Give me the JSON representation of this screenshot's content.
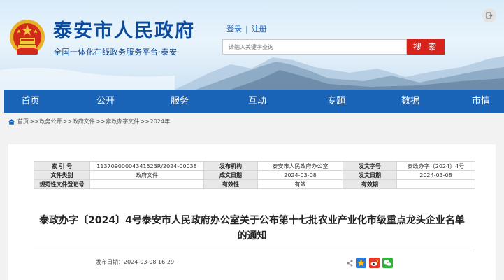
{
  "header": {
    "site_title": "泰安市人民政府",
    "site_subtitle": "全国一体化在线政务服务平台·泰安",
    "login_label": "登录",
    "register_label": "注册",
    "search_placeholder": "请输入关键字查询",
    "search_button": "搜 索"
  },
  "nav": {
    "items": [
      {
        "label": "首页"
      },
      {
        "label": "公开"
      },
      {
        "label": "服务"
      },
      {
        "label": "互动"
      },
      {
        "label": "专题"
      },
      {
        "label": "数据"
      },
      {
        "label": "市情"
      }
    ]
  },
  "breadcrumb": {
    "items": [
      "首页",
      "政务公开",
      "政府文件",
      "泰政办字文件",
      "2024年"
    ],
    "separator": ">>"
  },
  "meta": {
    "index_key": "索 引 号",
    "index_value": "11370900004341523R/2024-00038",
    "issuer_key": "发布机构",
    "issuer_value": "泰安市人民政府办公室",
    "doc_no_key": "发文字号",
    "doc_no_value": "泰政办字〔2024〕4号",
    "category_key": "文件类别",
    "category_value": "政府文件",
    "created_key": "成文日期",
    "created_value": "2024-03-08",
    "issued_key": "发文日期",
    "issued_value": "2024-03-08",
    "reg_key": "规范性文件登记号",
    "reg_value": "",
    "validity_key": "有效性",
    "validity_value": "有效",
    "expiry_key": "有效期",
    "expiry_value": ""
  },
  "document": {
    "title_line1": "泰政办字〔2024〕4号泰安市人民政府办公室关于公布第十七批农业产业化市级重点龙头企业名单",
    "title_line2": "的通知",
    "publish_date": "发布日期：2024-03-08 16:29"
  },
  "colors": {
    "nav_bg": "#1a64b8",
    "title_blue": "#0c4b9c",
    "search_red": "#d8231c"
  },
  "icons": {
    "share": "share-icon",
    "qzone": "qzone-icon",
    "weibo": "weibo-icon",
    "wechat": "wechat-icon"
  }
}
